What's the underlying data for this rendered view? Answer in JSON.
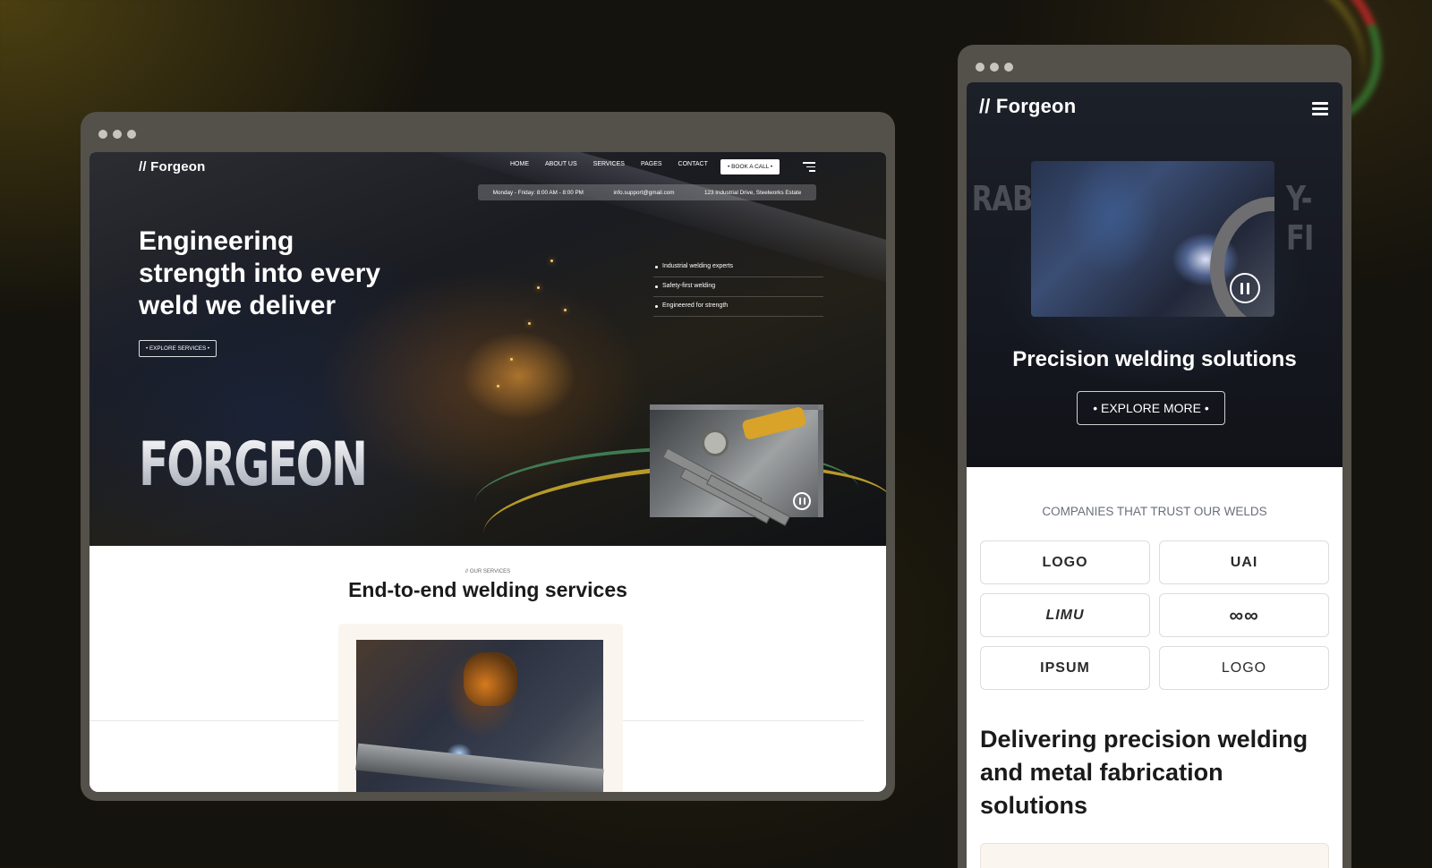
{
  "desktop": {
    "brand": "// Forgeon",
    "nav": [
      "HOME",
      "ABOUT US",
      "SERVICES",
      "PAGES",
      "CONTACT"
    ],
    "book_call": "• BOOK A CALL •",
    "info": {
      "hours": "Monday - Friday: 8:00 AM - 8:00 PM",
      "email": "info.support@gmail.com",
      "address": "123 Industrial Drive, Steelworks Estate"
    },
    "headline": "Engineering strength into every weld we deliver",
    "explore_button": "• EXPLORE SERVICES •",
    "bullets": [
      "Industrial welding experts",
      "Safety-first welding",
      "Engineered for strength"
    ],
    "big_brand": "FORGEON",
    "services_kicker": "// OUR SERVICES",
    "services_title": "End-to-end welding services"
  },
  "mobile": {
    "brand": "// Forgeon",
    "bg_text_left": "RABI",
    "bg_text_right": "Y-FI",
    "hero_title": "Precision welding solutions",
    "explore_button": "• EXPLORE MORE •",
    "trust_heading": "COMPANIES THAT TRUST OUR WELDS",
    "logos": [
      "LOGO",
      "UAI",
      "LIMU",
      "∞∞",
      "IPSUM",
      "LOGO"
    ],
    "heading": "Delivering precision welding and metal fabrication solutions"
  },
  "colors": {
    "background": "#15130d",
    "window_frame": "#54504a",
    "hero_dark": "#1a1c22",
    "accent_card": "#faf6ef"
  },
  "icons": [
    "menu-icon",
    "pause-icon",
    "window-dots"
  ]
}
